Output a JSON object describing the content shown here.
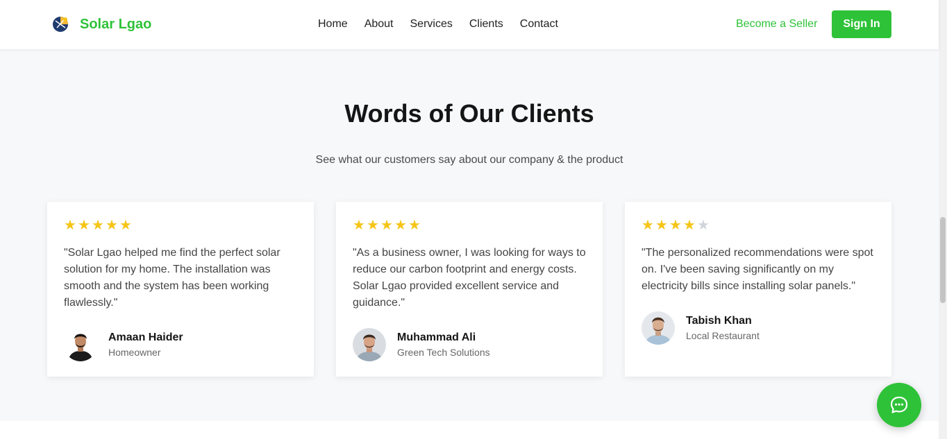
{
  "header": {
    "brand": "Solar Lgao",
    "nav": [
      "Home",
      "About",
      "Services",
      "Clients",
      "Contact"
    ],
    "seller_link": "Become a Seller",
    "signin_label": "Sign In"
  },
  "section": {
    "title": "Words of Our Clients",
    "subtitle": "See what our customers say about our company & the product"
  },
  "testimonials": [
    {
      "rating": 5,
      "quote": "\"Solar Lgao helped me find the perfect solar solution for my home. The installation was smooth and the system has been working flawlessly.\"",
      "name": "Amaan Haider",
      "role": "Homeowner"
    },
    {
      "rating": 5,
      "quote": "\"As a business owner, I was looking for ways to reduce our carbon footprint and energy costs. Solar Lgao provided excellent service and guidance.\"",
      "name": "Muhammad Ali",
      "role": "Green Tech Solutions"
    },
    {
      "rating": 4,
      "quote": "\"The personalized recommendations were spot on. I've been saving significantly on my electricity bills since installing solar panels.\"",
      "name": "Tabish Khan",
      "role": "Local Restaurant"
    }
  ],
  "colors": {
    "brand": "#2ec238",
    "star": "#f5c518",
    "star_empty": "#d1d5db"
  },
  "icons": {
    "logo": "solar-logo-icon",
    "star": "star-icon",
    "chat": "chat-bubble-icon"
  }
}
